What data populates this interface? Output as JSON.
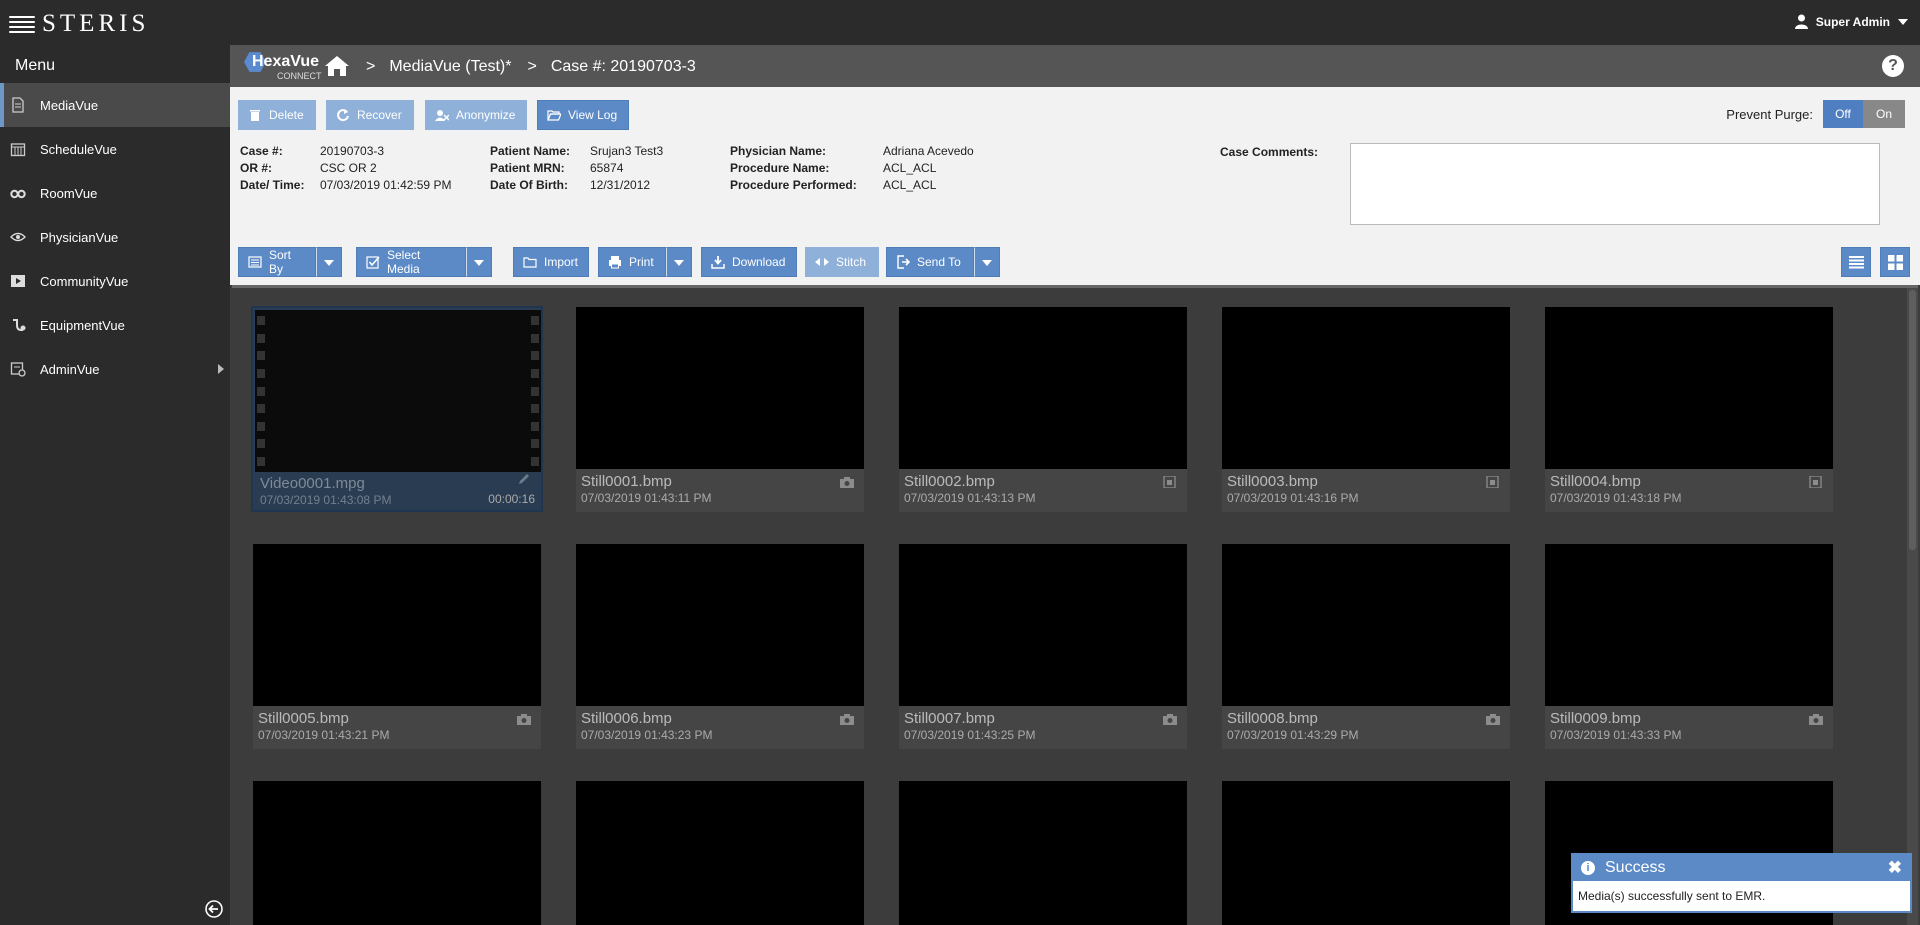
{
  "brand": {
    "logo_text": "STERIS"
  },
  "user": {
    "name": "Super Admin"
  },
  "sidebar": {
    "title": "Menu",
    "items": [
      {
        "label": "MediaVue",
        "icon": "document-icon",
        "active": true
      },
      {
        "label": "ScheduleVue",
        "icon": "calendar-icon"
      },
      {
        "label": "RoomVue",
        "icon": "binoculars-icon"
      },
      {
        "label": "PhysicianVue",
        "icon": "eye-icon"
      },
      {
        "label": "CommunityVue",
        "icon": "play-icon"
      },
      {
        "label": "EquipmentVue",
        "icon": "equipment-icon"
      },
      {
        "label": "AdminVue",
        "icon": "admin-icon",
        "has_submenu": true
      }
    ]
  },
  "header": {
    "app_name": "HexaVue",
    "app_sub": "CONNECT",
    "sep": ">",
    "breadcrumb": [
      "MediaVue (Test)*",
      "Case #: 20190703-3"
    ],
    "help": "?"
  },
  "toolbar": {
    "delete": "Delete",
    "recover": "Recover",
    "anonymize": "Anonymize",
    "view_log": "View Log",
    "prevent_purge_label": "Prevent Purge:",
    "purge_off": "Off",
    "purge_on": "On"
  },
  "case_info": {
    "case_no_label": "Case #:",
    "case_no": "20190703-3",
    "or_label": "OR #:",
    "or": "CSC OR 2",
    "datetime_label": "Date/ Time:",
    "datetime": "07/03/2019 01:42:59 PM",
    "patient_name_label": "Patient Name:",
    "patient_name": "Srujan3 Test3",
    "mrn_label": "Patient MRN:",
    "mrn": "65874",
    "dob_label": "Date Of Birth:",
    "dob": "12/31/2012",
    "physician_label": "Physician Name:",
    "physician": "Adriana Acevedo",
    "procedure_label": "Procedure Name:",
    "procedure": "ACL_ACL",
    "performed_label": "Procedure Performed:",
    "performed": "ACL_ACL",
    "comments_label": "Case Comments:",
    "comments": ""
  },
  "media_toolbar": {
    "sort_by": "Sort By",
    "select_media": "Select Media",
    "import": "Import",
    "print": "Print",
    "download": "Download",
    "stitch": "Stitch",
    "send_to": "Send To"
  },
  "media": [
    {
      "name": "Video0001.mpg",
      "date": "07/03/2019 01:43:08 PM",
      "duration": "00:00:16",
      "type": "video",
      "selected": true
    },
    {
      "name": "Still0001.bmp",
      "date": "07/03/2019 01:43:11 PM",
      "type": "camera"
    },
    {
      "name": "Still0002.bmp",
      "date": "07/03/2019 01:43:13 PM",
      "type": "doc"
    },
    {
      "name": "Still0003.bmp",
      "date": "07/03/2019 01:43:16 PM",
      "type": "doc"
    },
    {
      "name": "Still0004.bmp",
      "date": "07/03/2019 01:43:18 PM",
      "type": "doc"
    },
    {
      "name": "Still0005.bmp",
      "date": "07/03/2019 01:43:21 PM",
      "type": "camera"
    },
    {
      "name": "Still0006.bmp",
      "date": "07/03/2019 01:43:23 PM",
      "type": "camera"
    },
    {
      "name": "Still0007.bmp",
      "date": "07/03/2019 01:43:25 PM",
      "type": "camera"
    },
    {
      "name": "Still0008.bmp",
      "date": "07/03/2019 01:43:29 PM",
      "type": "camera"
    },
    {
      "name": "Still0009.bmp",
      "date": "07/03/2019 01:43:33 PM",
      "type": "camera"
    },
    {
      "name": "",
      "date": "",
      "type": "camera"
    },
    {
      "name": "",
      "date": "",
      "type": "camera"
    },
    {
      "name": "",
      "date": "",
      "type": "camera"
    },
    {
      "name": "",
      "date": "",
      "type": "camera"
    },
    {
      "name": "",
      "date": "",
      "type": "camera"
    }
  ],
  "toast": {
    "title": "Success",
    "message": "Media(s) successfully sent to EMR.",
    "close": "✖"
  },
  "colors": {
    "accent": "#5b8ac6",
    "sidebar_bg": "#2b2b2b",
    "header_bg": "#555555"
  }
}
